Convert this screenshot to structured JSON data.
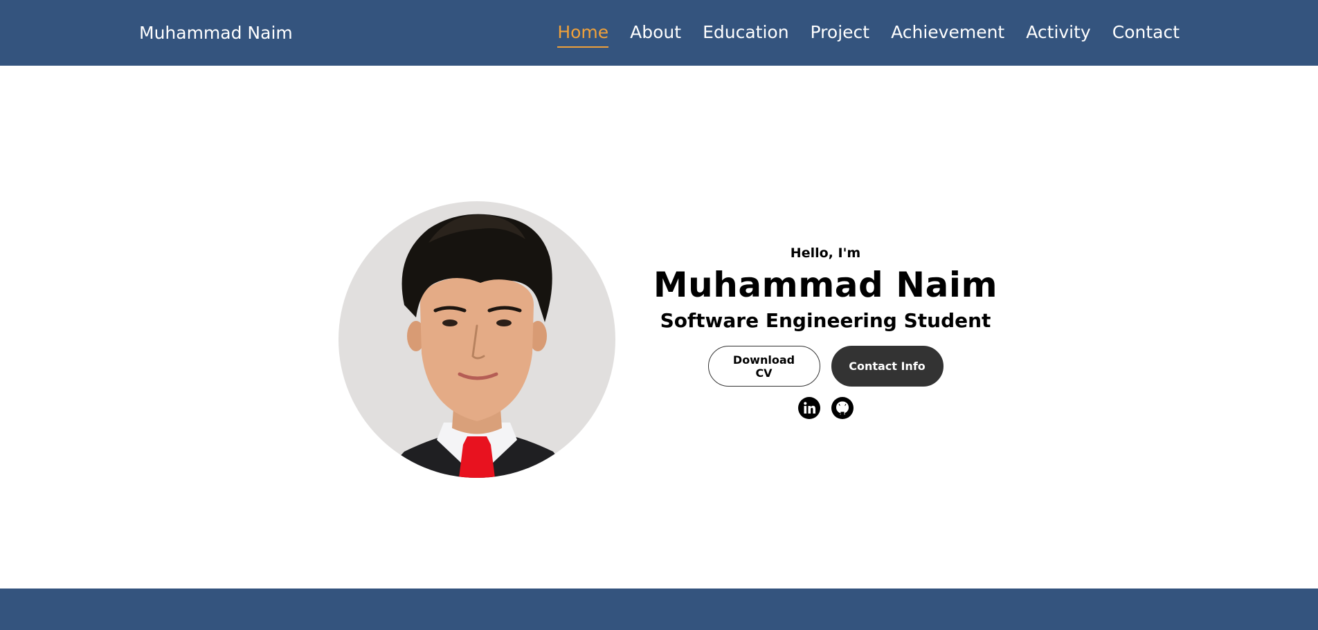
{
  "colors": {
    "nav_bg": "#34547e",
    "accent": "#f0a13a",
    "button_dark": "#333333",
    "photo_bg": "#e1dfde"
  },
  "nav": {
    "brand": "Muhammad Naim",
    "links": [
      {
        "label": "Home",
        "active": true
      },
      {
        "label": "About"
      },
      {
        "label": "Education"
      },
      {
        "label": "Project"
      },
      {
        "label": "Achievement"
      },
      {
        "label": "Activity"
      },
      {
        "label": "Contact"
      }
    ]
  },
  "hero": {
    "greeting": "Hello, I'm",
    "name": "Muhammad Naim",
    "title": "Software Engineering Student",
    "buttons": {
      "download_cv": "Download CV",
      "contact_info": "Contact Info"
    },
    "social_icons": [
      "linkedin-icon",
      "github-icon"
    ]
  }
}
